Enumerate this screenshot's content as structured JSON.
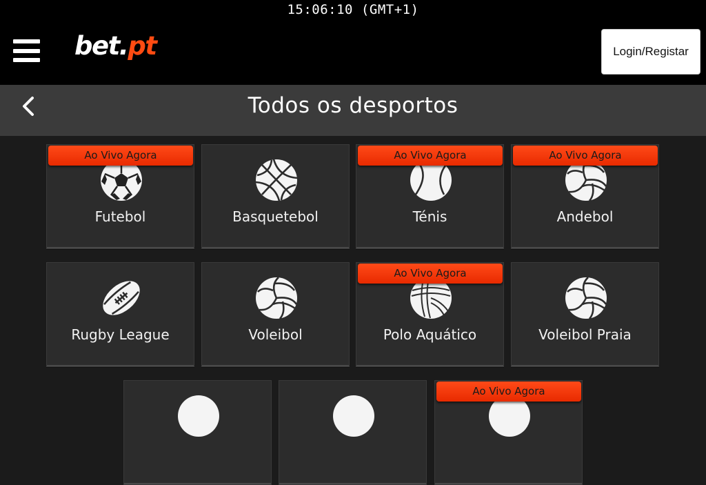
{
  "status_bar": {
    "clock": "15:06:10 (GMT+1)"
  },
  "header": {
    "logo_part1": "bet.",
    "logo_part2": "pt",
    "login_label": "Login/Registar"
  },
  "subheader": {
    "title": "Todos os desportos"
  },
  "live_badge_label": "Ao Vivo Agora",
  "sports": [
    {
      "name": "Futebol",
      "icon": "soccer-ball-icon",
      "live": true
    },
    {
      "name": "Basquetebol",
      "icon": "basketball-icon",
      "live": false
    },
    {
      "name": "Ténis",
      "icon": "tennis-ball-icon",
      "live": true
    },
    {
      "name": "Andebol",
      "icon": "handball-icon",
      "live": true
    },
    {
      "name": "Rugby League",
      "icon": "rugby-ball-icon",
      "live": false
    },
    {
      "name": "Voleibol",
      "icon": "volleyball-icon",
      "live": false
    },
    {
      "name": "Polo Aquático",
      "icon": "water-polo-ball-icon",
      "live": true
    },
    {
      "name": "Voleibol Praia",
      "icon": "beach-volleyball-icon",
      "live": false
    },
    {
      "name": "",
      "icon": "sport-icon",
      "live": false
    },
    {
      "name": "",
      "icon": "sport-icon",
      "live": false
    },
    {
      "name": "",
      "icon": "sport-icon",
      "live": true
    }
  ],
  "colors": {
    "accent": "#ff4b12",
    "background": "#1b1b1b",
    "tile": "#2c2c2c",
    "header": "#000000",
    "subheader": "#3b3b3b"
  }
}
